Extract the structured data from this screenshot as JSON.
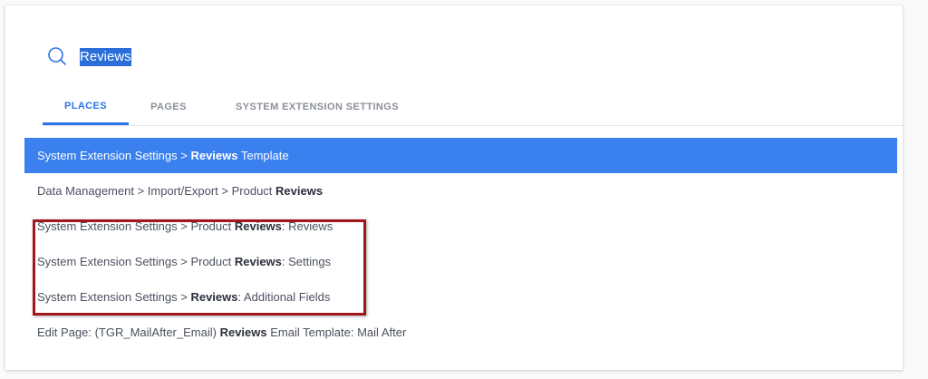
{
  "search": {
    "value": "Reviews"
  },
  "tabs": [
    {
      "label": "PLACES",
      "active": true
    },
    {
      "label": "PAGES",
      "active": false
    },
    {
      "label": "SYSTEM EXTENSION SETTINGS",
      "active": false
    }
  ],
  "results": [
    {
      "pre": "System Extension Settings > ",
      "match": "Reviews",
      "post": " Template",
      "selected": true
    },
    {
      "pre": "Data Management > Import/Export > Product ",
      "match": "Reviews",
      "post": "",
      "selected": false
    },
    {
      "pre": "System Extension Settings > Product ",
      "match": "Reviews",
      "post": ": Reviews",
      "selected": false
    },
    {
      "pre": "System Extension Settings > Product ",
      "match": "Reviews",
      "post": ": Settings",
      "selected": false
    },
    {
      "pre": "System Extension Settings > ",
      "match": "Reviews",
      "post": ": Additional Fields",
      "selected": false
    },
    {
      "pre": "Edit Page: (TGR_MailAfter_Email) ",
      "match": "Reviews",
      "post": " Email Template: Mail After",
      "selected": false
    }
  ],
  "colors": {
    "accent": "#3a80ef",
    "tab_active": "#2d74e6",
    "highlight_box": "#a3161c",
    "selection": "#2b6ed8"
  },
  "icons": {
    "search": "search-icon"
  }
}
